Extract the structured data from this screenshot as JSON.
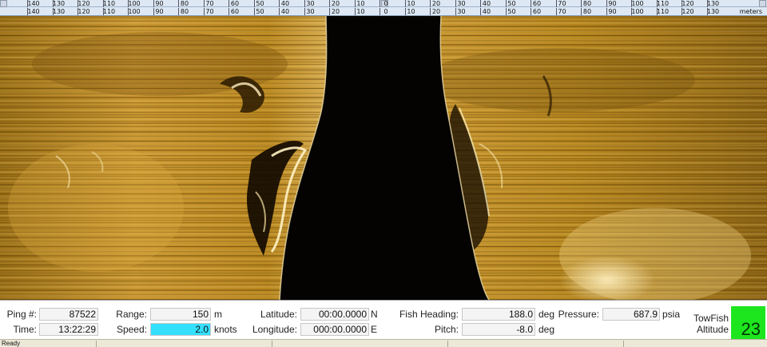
{
  "ruler": {
    "top_labels": [
      "140",
      "130",
      "120",
      "110",
      "100",
      "90",
      "80",
      "70",
      "60",
      "50",
      "40",
      "30",
      "20",
      "10",
      "0",
      "10",
      "20",
      "30",
      "40",
      "50",
      "60",
      "70",
      "80",
      "90",
      "100",
      "110",
      "120",
      "130"
    ],
    "bottom_labels": [
      "140",
      "130",
      "120",
      "110",
      "100",
      "90",
      "80",
      "70",
      "60",
      "50",
      "40",
      "30",
      "20",
      "10",
      "0",
      "10",
      "20",
      "30",
      "40",
      "50",
      "60",
      "70",
      "80",
      "90",
      "100",
      "110",
      "120",
      "130"
    ],
    "units": "meters"
  },
  "telemetry": {
    "ping_label": "Ping #:",
    "ping_value": "87522",
    "time_label": "Time:",
    "time_value": "13:22:29",
    "range_label": "Range:",
    "range_value": "150",
    "range_unit": "m",
    "speed_label": "Speed:",
    "speed_value": "2.0",
    "speed_unit": "knots",
    "latitude_label": "Latitude:",
    "latitude_value": "00:00.0000",
    "latitude_hemi": "N",
    "longitude_label": "Longitude:",
    "longitude_value": "000:00.0000",
    "longitude_hemi": "E",
    "heading_label": "Fish Heading:",
    "heading_value": "188.0",
    "heading_unit": "deg",
    "pitch_label": "Pitch:",
    "pitch_value": "-8.0",
    "pitch_unit": "deg",
    "pressure_label": "Pressure:",
    "pressure_value": "687.9",
    "pressure_unit": "psia",
    "towfish_label": "TowFish",
    "altitude_label": "Altitude",
    "altitude_value": "23"
  },
  "status": {
    "text": "Ready"
  },
  "colors": {
    "sonar_gold": "#c8962a",
    "water_column": "#050302",
    "speed_highlight": "#35e0ff",
    "altitude_green": "#1ee61e"
  }
}
